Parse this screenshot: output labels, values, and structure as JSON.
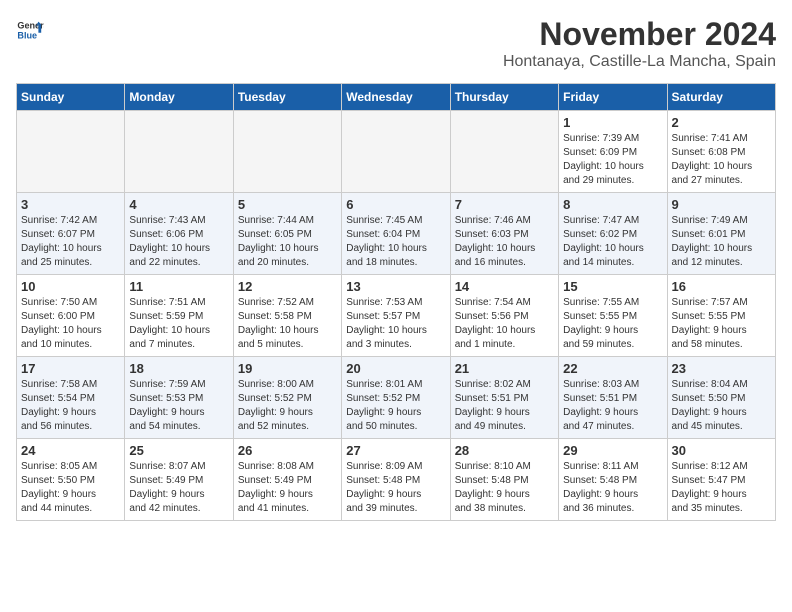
{
  "logo": {
    "line1": "General",
    "line2": "Blue"
  },
  "title": "November 2024",
  "location": "Hontanaya, Castille-La Mancha, Spain",
  "headers": [
    "Sunday",
    "Monday",
    "Tuesday",
    "Wednesday",
    "Thursday",
    "Friday",
    "Saturday"
  ],
  "weeks": [
    [
      {
        "day": "",
        "info": ""
      },
      {
        "day": "",
        "info": ""
      },
      {
        "day": "",
        "info": ""
      },
      {
        "day": "",
        "info": ""
      },
      {
        "day": "",
        "info": ""
      },
      {
        "day": "1",
        "info": "Sunrise: 7:39 AM\nSunset: 6:09 PM\nDaylight: 10 hours\nand 29 minutes."
      },
      {
        "day": "2",
        "info": "Sunrise: 7:41 AM\nSunset: 6:08 PM\nDaylight: 10 hours\nand 27 minutes."
      }
    ],
    [
      {
        "day": "3",
        "info": "Sunrise: 7:42 AM\nSunset: 6:07 PM\nDaylight: 10 hours\nand 25 minutes."
      },
      {
        "day": "4",
        "info": "Sunrise: 7:43 AM\nSunset: 6:06 PM\nDaylight: 10 hours\nand 22 minutes."
      },
      {
        "day": "5",
        "info": "Sunrise: 7:44 AM\nSunset: 6:05 PM\nDaylight: 10 hours\nand 20 minutes."
      },
      {
        "day": "6",
        "info": "Sunrise: 7:45 AM\nSunset: 6:04 PM\nDaylight: 10 hours\nand 18 minutes."
      },
      {
        "day": "7",
        "info": "Sunrise: 7:46 AM\nSunset: 6:03 PM\nDaylight: 10 hours\nand 16 minutes."
      },
      {
        "day": "8",
        "info": "Sunrise: 7:47 AM\nSunset: 6:02 PM\nDaylight: 10 hours\nand 14 minutes."
      },
      {
        "day": "9",
        "info": "Sunrise: 7:49 AM\nSunset: 6:01 PM\nDaylight: 10 hours\nand 12 minutes."
      }
    ],
    [
      {
        "day": "10",
        "info": "Sunrise: 7:50 AM\nSunset: 6:00 PM\nDaylight: 10 hours\nand 10 minutes."
      },
      {
        "day": "11",
        "info": "Sunrise: 7:51 AM\nSunset: 5:59 PM\nDaylight: 10 hours\nand 7 minutes."
      },
      {
        "day": "12",
        "info": "Sunrise: 7:52 AM\nSunset: 5:58 PM\nDaylight: 10 hours\nand 5 minutes."
      },
      {
        "day": "13",
        "info": "Sunrise: 7:53 AM\nSunset: 5:57 PM\nDaylight: 10 hours\nand 3 minutes."
      },
      {
        "day": "14",
        "info": "Sunrise: 7:54 AM\nSunset: 5:56 PM\nDaylight: 10 hours\nand 1 minute."
      },
      {
        "day": "15",
        "info": "Sunrise: 7:55 AM\nSunset: 5:55 PM\nDaylight: 9 hours\nand 59 minutes."
      },
      {
        "day": "16",
        "info": "Sunrise: 7:57 AM\nSunset: 5:55 PM\nDaylight: 9 hours\nand 58 minutes."
      }
    ],
    [
      {
        "day": "17",
        "info": "Sunrise: 7:58 AM\nSunset: 5:54 PM\nDaylight: 9 hours\nand 56 minutes."
      },
      {
        "day": "18",
        "info": "Sunrise: 7:59 AM\nSunset: 5:53 PM\nDaylight: 9 hours\nand 54 minutes."
      },
      {
        "day": "19",
        "info": "Sunrise: 8:00 AM\nSunset: 5:52 PM\nDaylight: 9 hours\nand 52 minutes."
      },
      {
        "day": "20",
        "info": "Sunrise: 8:01 AM\nSunset: 5:52 PM\nDaylight: 9 hours\nand 50 minutes."
      },
      {
        "day": "21",
        "info": "Sunrise: 8:02 AM\nSunset: 5:51 PM\nDaylight: 9 hours\nand 49 minutes."
      },
      {
        "day": "22",
        "info": "Sunrise: 8:03 AM\nSunset: 5:51 PM\nDaylight: 9 hours\nand 47 minutes."
      },
      {
        "day": "23",
        "info": "Sunrise: 8:04 AM\nSunset: 5:50 PM\nDaylight: 9 hours\nand 45 minutes."
      }
    ],
    [
      {
        "day": "24",
        "info": "Sunrise: 8:05 AM\nSunset: 5:50 PM\nDaylight: 9 hours\nand 44 minutes."
      },
      {
        "day": "25",
        "info": "Sunrise: 8:07 AM\nSunset: 5:49 PM\nDaylight: 9 hours\nand 42 minutes."
      },
      {
        "day": "26",
        "info": "Sunrise: 8:08 AM\nSunset: 5:49 PM\nDaylight: 9 hours\nand 41 minutes."
      },
      {
        "day": "27",
        "info": "Sunrise: 8:09 AM\nSunset: 5:48 PM\nDaylight: 9 hours\nand 39 minutes."
      },
      {
        "day": "28",
        "info": "Sunrise: 8:10 AM\nSunset: 5:48 PM\nDaylight: 9 hours\nand 38 minutes."
      },
      {
        "day": "29",
        "info": "Sunrise: 8:11 AM\nSunset: 5:48 PM\nDaylight: 9 hours\nand 36 minutes."
      },
      {
        "day": "30",
        "info": "Sunrise: 8:12 AM\nSunset: 5:47 PM\nDaylight: 9 hours\nand 35 minutes."
      }
    ]
  ]
}
